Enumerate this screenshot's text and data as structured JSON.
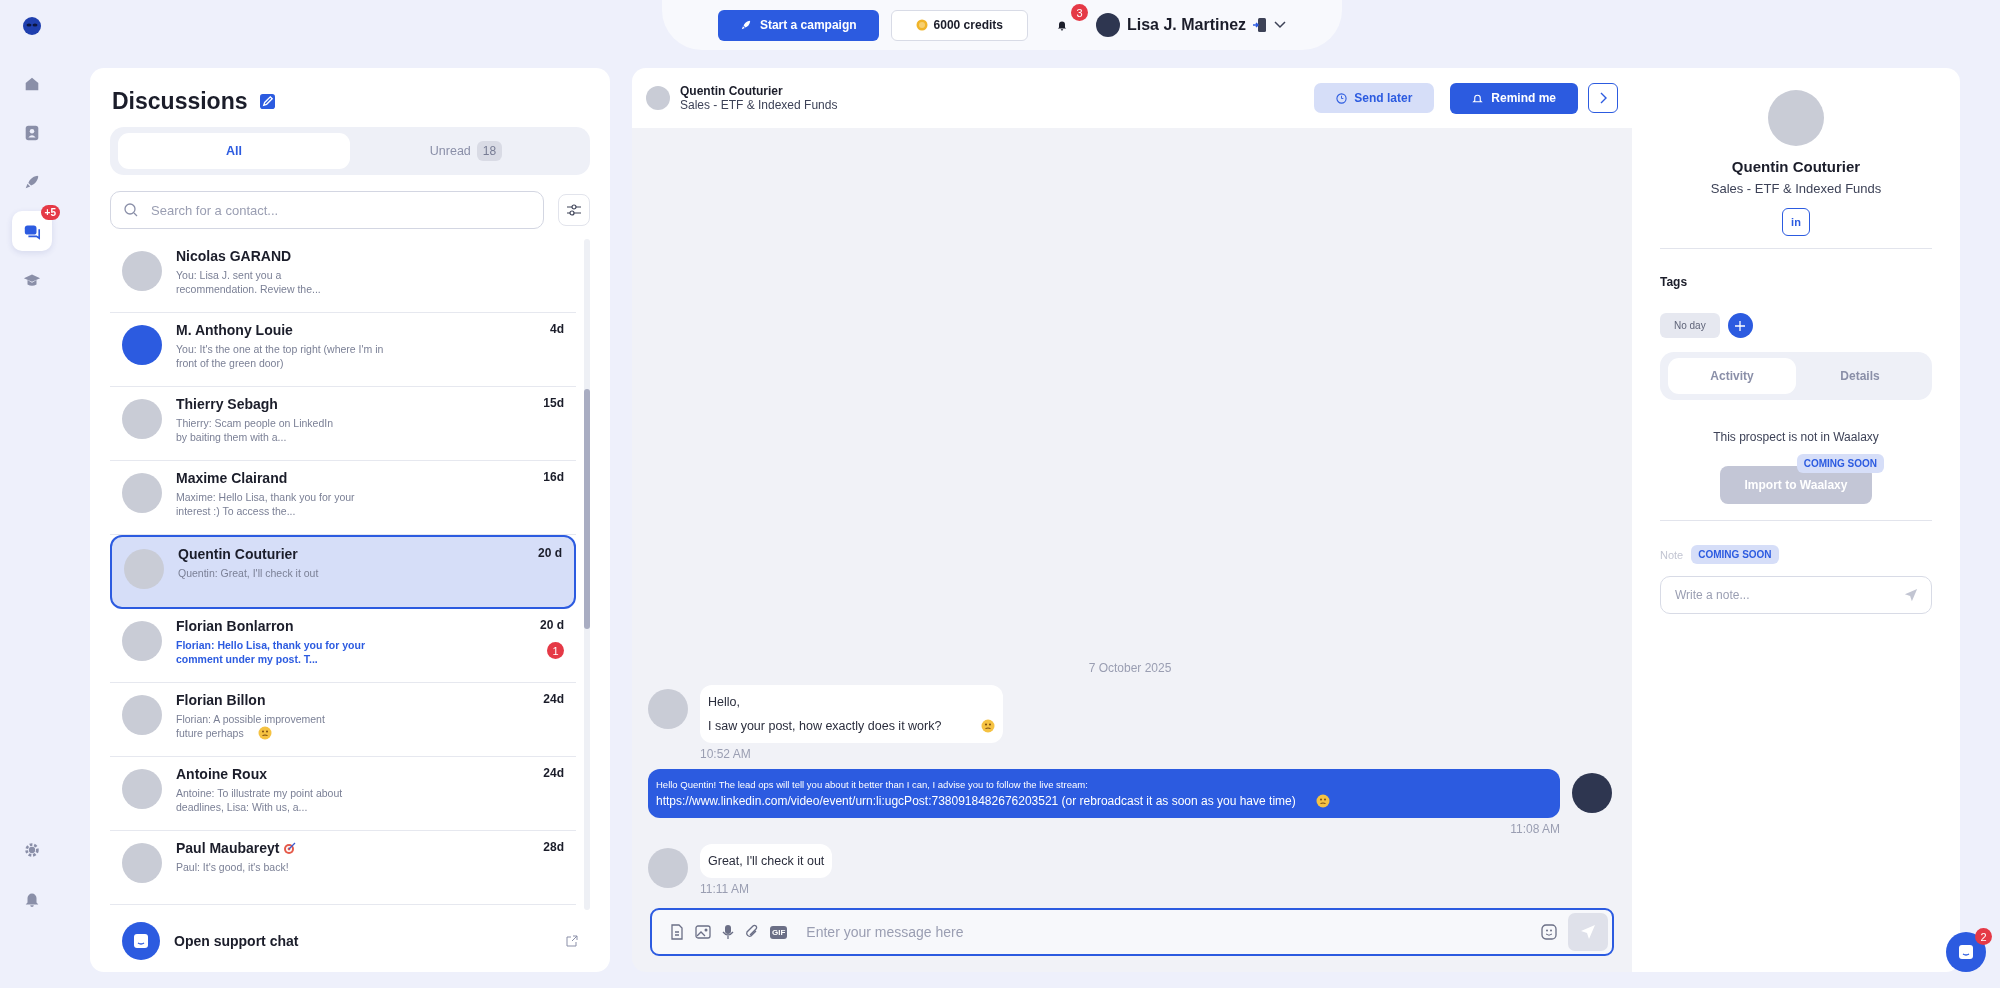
{
  "nav": {
    "items": [
      {
        "selected": false
      },
      {
        "selected": false
      },
      {
        "selected": false
      },
      {
        "selected": true,
        "badge": "+5"
      },
      {
        "selected": false
      }
    ]
  },
  "topbar": {
    "campaign_button": "Start a campaign",
    "credits": "6000 credits",
    "notifications": "3",
    "user": "Lisa J. Martinez"
  },
  "discussions": {
    "title": "Discussions",
    "tabs": [
      {
        "label": "All",
        "selected": true
      },
      {
        "label": "Unread",
        "count": "18",
        "selected": false
      }
    ],
    "search": {
      "placeholder": "Search for a contact..."
    },
    "items": [
      {
        "name": "Nicolas GARAND",
        "preview": [
          "You: Lisa J. sent you a",
          "recommendation. Review the..."
        ],
        "unread": false,
        "selected": false
      },
      {
        "name": "M. Anthony Louie",
        "preview": [
          "You: It's the one at the top right (where I'm in",
          "front of the green door)"
        ],
        "time": "4d",
        "unread": false,
        "selected": false,
        "avatar_ring": true
      },
      {
        "name": "Thierry Sebagh",
        "preview": [
          "Thierry: Scam people on LinkedIn",
          "by baiting them with a..."
        ],
        "time": "15d",
        "unread": false,
        "selected": false
      },
      {
        "name": "Maxime Clairand",
        "preview": [
          "Maxime: Hello Lisa, thank you for your",
          "interest :) To access the..."
        ],
        "time": "16d",
        "unread": false,
        "selected": false
      },
      {
        "name": "Quentin Couturier",
        "preview": [
          "Quentin: Great, I'll check it out"
        ],
        "time": "20 d",
        "unread": false,
        "selected": true
      },
      {
        "name": "Florian Bonlarron",
        "preview": [
          "Florian: Hello Lisa, thank you for your",
          "comment under my post. T..."
        ],
        "time": "20 d",
        "unread": true,
        "unread_count": "1",
        "selected": false
      },
      {
        "name": "Florian Billon",
        "preview": [
          "Florian: A possible improvement",
          "future perhaps"
        ],
        "time": "24d",
        "unread": false,
        "selected": false,
        "emoji": true
      },
      {
        "name": "Antoine Roux",
        "preview": [
          "Antoine: To illustrate my point about",
          "deadlines, Lisa: With us, a..."
        ],
        "time": "24d",
        "unread": false,
        "selected": false
      },
      {
        "name": "Paul Maubareyt",
        "preview": [
          "Paul: It's good, it's back!"
        ],
        "time": "28d",
        "unread": false,
        "selected": false,
        "name_icon": true
      }
    ],
    "support": "Open support chat"
  },
  "chat": {
    "contact": {
      "name": "Quentin Couturier",
      "subtitle": "Sales - ETF & Indexed Funds"
    },
    "send_later": "Send later",
    "remind": "Remind me",
    "date": "7 October 2025",
    "messages": [
      {
        "kind": "incoming",
        "lines": [
          "Hello,",
          "I saw your post, how exactly does it work?"
        ],
        "time": "10:52 AM",
        "emoji": true
      },
      {
        "kind": "outgoing",
        "lines": [
          "Hello Quentin! The lead ops will tell you about it better than I can, I advise you to follow the live stream:",
          "https://www.linkedin.com/video/event/urn:li:ugcPost:7380918482676203521 (or rebroadcast it as soon as you have time)"
        ],
        "time": "11:08 AM",
        "emoji": true
      },
      {
        "kind": "incoming",
        "lines": [
          "Great, I'll check it out"
        ],
        "time": "11:11 AM"
      }
    ],
    "composer": {
      "placeholder": "Enter your message here",
      "gif": "GIF"
    }
  },
  "profile": {
    "name": "Quentin Couturier",
    "subtitle": "Sales - ETF & Indexed Funds",
    "linkedin": "in",
    "tags_title": "Tags",
    "tag": "No day",
    "tabs": [
      {
        "label": "Activity",
        "selected": true
      },
      {
        "label": "Details",
        "selected": false
      }
    ],
    "status": "This prospect is not in Waalaxy",
    "import_button": "Import to Waalaxy",
    "import_disabled": true,
    "import_badge": "COMING SOON",
    "note_label": "Note",
    "note_badge": "COMING SOON",
    "note_placeholder": "Write a note..."
  },
  "support_bubble": {
    "count": "2"
  }
}
